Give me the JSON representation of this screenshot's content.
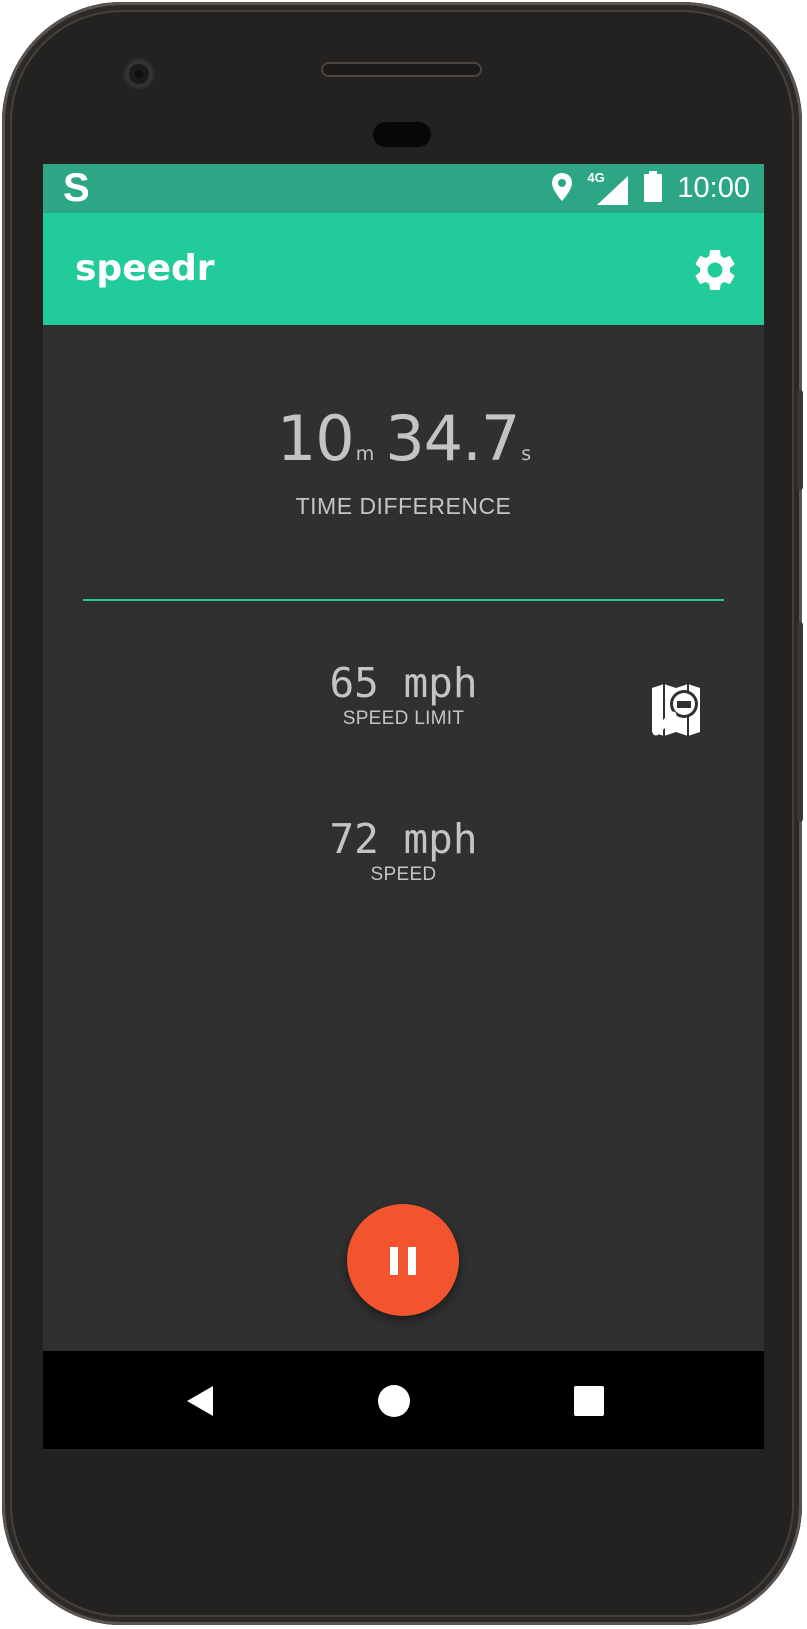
{
  "status_bar": {
    "app_badge": "S",
    "location_icon": "location-pin-icon",
    "network_label": "4G",
    "signal_icon": "cell-signal-icon",
    "battery_icon": "battery-icon",
    "time": "10:00"
  },
  "app_bar": {
    "title": "speedr",
    "settings_icon": "gear-icon"
  },
  "time_difference": {
    "minutes": "10",
    "minutes_unit": "m",
    "seconds": "34.7",
    "seconds_unit": "s",
    "label": "TIME DIFFERENCE"
  },
  "speed_limit": {
    "value": "65 mph",
    "label": "SPEED LIMIT",
    "source_icon": "map-search-icon"
  },
  "speed": {
    "value": "72 mph",
    "label": "SPEED"
  },
  "fab": {
    "icon": "pause-icon"
  },
  "nav": {
    "back_icon": "back-triangle-icon",
    "home_icon": "home-circle-icon",
    "recents_icon": "recents-square-icon"
  },
  "colors": {
    "accent": "#21cc9a",
    "status_bar": "#2ca684",
    "background": "#303030",
    "fab": "#f2552e",
    "text": "#c4c4c4",
    "divider": "#2fc494"
  }
}
